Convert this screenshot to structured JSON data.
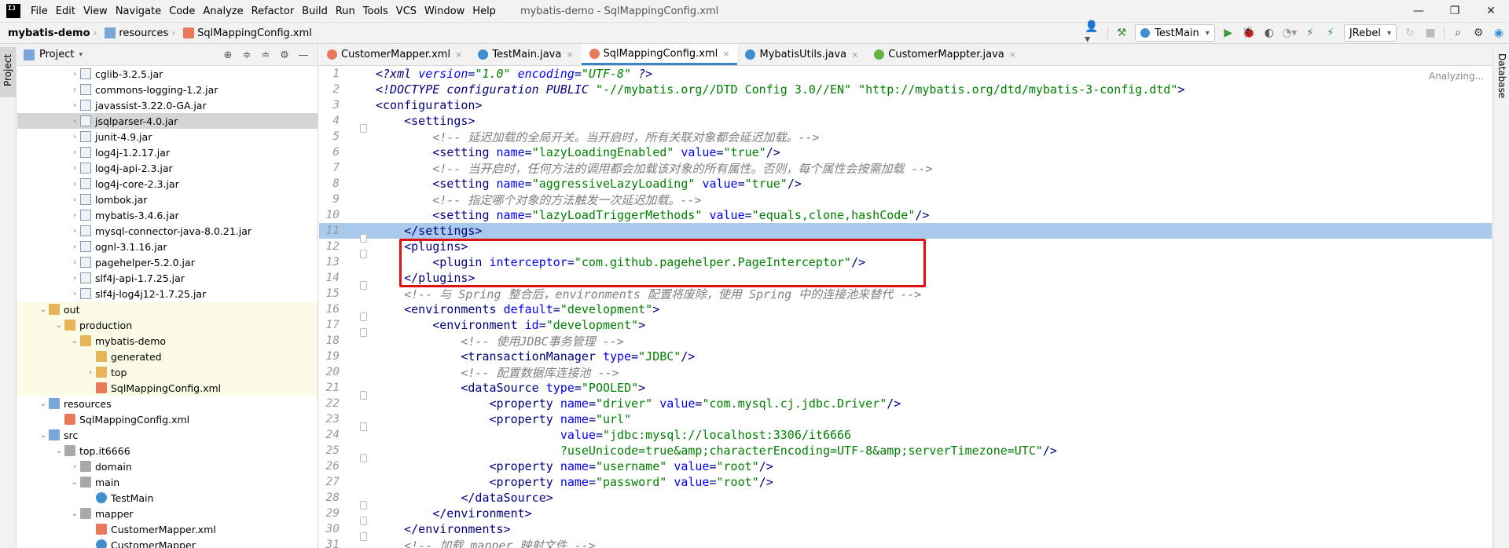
{
  "menubar": {
    "items": [
      "File",
      "Edit",
      "View",
      "Navigate",
      "Code",
      "Analyze",
      "Refactor",
      "Build",
      "Run",
      "Tools",
      "VCS",
      "Window",
      "Help"
    ],
    "window_title": "mybatis-demo - SqlMappingConfig.xml"
  },
  "navbar": {
    "breadcrumb": [
      "mybatis-demo",
      "resources",
      "SqlMappingConfig.xml"
    ],
    "run_config": "TestMain",
    "jrebel": "JRebel"
  },
  "left_stripe": {
    "project_label": "Project"
  },
  "right_stripe": {
    "database_label": "Database"
  },
  "project_panel": {
    "title": "Project",
    "tree": [
      {
        "label": "cglib-3.2.5.jar",
        "indent": 3,
        "arrow": "›",
        "icon": "jar",
        "selected": false,
        "excluded": false
      },
      {
        "label": "commons-logging-1.2.jar",
        "indent": 3,
        "arrow": "›",
        "icon": "jar",
        "selected": false,
        "excluded": false
      },
      {
        "label": "javassist-3.22.0-GA.jar",
        "indent": 3,
        "arrow": "›",
        "icon": "jar",
        "selected": false,
        "excluded": false
      },
      {
        "label": "jsqlparser-4.0.jar",
        "indent": 3,
        "arrow": "›",
        "icon": "jar",
        "selected": true,
        "excluded": false
      },
      {
        "label": "junit-4.9.jar",
        "indent": 3,
        "arrow": "›",
        "icon": "jar",
        "selected": false,
        "excluded": false
      },
      {
        "label": "log4j-1.2.17.jar",
        "indent": 3,
        "arrow": "›",
        "icon": "jar",
        "selected": false,
        "excluded": false
      },
      {
        "label": "log4j-api-2.3.jar",
        "indent": 3,
        "arrow": "›",
        "icon": "jar",
        "selected": false,
        "excluded": false
      },
      {
        "label": "log4j-core-2.3.jar",
        "indent": 3,
        "arrow": "›",
        "icon": "jar",
        "selected": false,
        "excluded": false
      },
      {
        "label": "lombok.jar",
        "indent": 3,
        "arrow": "›",
        "icon": "jar",
        "selected": false,
        "excluded": false
      },
      {
        "label": "mybatis-3.4.6.jar",
        "indent": 3,
        "arrow": "›",
        "icon": "jar",
        "selected": false,
        "excluded": false
      },
      {
        "label": "mysql-connector-java-8.0.21.jar",
        "indent": 3,
        "arrow": "›",
        "icon": "jar",
        "selected": false,
        "excluded": false
      },
      {
        "label": "ognl-3.1.16.jar",
        "indent": 3,
        "arrow": "›",
        "icon": "jar",
        "selected": false,
        "excluded": false
      },
      {
        "label": "pagehelper-5.2.0.jar",
        "indent": 3,
        "arrow": "›",
        "icon": "jar",
        "selected": false,
        "excluded": false
      },
      {
        "label": "slf4j-api-1.7.25.jar",
        "indent": 3,
        "arrow": "›",
        "icon": "jar",
        "selected": false,
        "excluded": false
      },
      {
        "label": "slf4j-log4j12-1.7.25.jar",
        "indent": 3,
        "arrow": "›",
        "icon": "jar",
        "selected": false,
        "excluded": false
      },
      {
        "label": "out",
        "indent": 1,
        "arrow": "⌄",
        "icon": "folder",
        "selected": false,
        "excluded": true
      },
      {
        "label": "production",
        "indent": 2,
        "arrow": "⌄",
        "icon": "folder",
        "selected": false,
        "excluded": true
      },
      {
        "label": "mybatis-demo",
        "indent": 3,
        "arrow": "⌄",
        "icon": "folder",
        "selected": false,
        "excluded": true
      },
      {
        "label": "generated",
        "indent": 4,
        "arrow": "",
        "icon": "folder",
        "selected": false,
        "excluded": true
      },
      {
        "label": "top",
        "indent": 4,
        "arrow": "›",
        "icon": "folder",
        "selected": false,
        "excluded": true
      },
      {
        "label": "SqlMappingConfig.xml",
        "indent": 4,
        "arrow": "",
        "icon": "xml",
        "selected": false,
        "excluded": true
      },
      {
        "label": "resources",
        "indent": 1,
        "arrow": "⌄",
        "icon": "folder-blue",
        "selected": false,
        "excluded": false
      },
      {
        "label": "SqlMappingConfig.xml",
        "indent": 2,
        "arrow": "",
        "icon": "xml",
        "selected": false,
        "excluded": false
      },
      {
        "label": "src",
        "indent": 1,
        "arrow": "⌄",
        "icon": "folder-blue",
        "selected": false,
        "excluded": false
      },
      {
        "label": "top.it6666",
        "indent": 2,
        "arrow": "⌄",
        "icon": "pkg",
        "selected": false,
        "excluded": false
      },
      {
        "label": "domain",
        "indent": 3,
        "arrow": "›",
        "icon": "pkg",
        "selected": false,
        "excluded": false
      },
      {
        "label": "main",
        "indent": 3,
        "arrow": "⌄",
        "icon": "pkg",
        "selected": false,
        "excluded": false
      },
      {
        "label": "TestMain",
        "indent": 4,
        "arrow": "",
        "icon": "class",
        "selected": false,
        "excluded": false
      },
      {
        "label": "mapper",
        "indent": 3,
        "arrow": "⌄",
        "icon": "pkg",
        "selected": false,
        "excluded": false
      },
      {
        "label": "CustomerMapper.xml",
        "indent": 4,
        "arrow": "",
        "icon": "xml",
        "selected": false,
        "excluded": false
      },
      {
        "label": "CustomerMapper",
        "indent": 4,
        "arrow": "",
        "icon": "class",
        "selected": false,
        "excluded": false
      }
    ]
  },
  "editor": {
    "tabs": [
      {
        "label": "CustomerMapper.xml",
        "icon_color": "#e8795a",
        "active": false
      },
      {
        "label": "TestMain.java",
        "icon_color": "#3e8ed0",
        "active": false
      },
      {
        "label": "SqlMappingConfig.xml",
        "icon_color": "#e8795a",
        "active": true
      },
      {
        "label": "MybatisUtils.java",
        "icon_color": "#3e8ed0",
        "active": false
      },
      {
        "label": "CustomerMappter.java",
        "icon_color": "#62b543",
        "active": false
      }
    ],
    "status": "Analyzing...",
    "current_line": 11,
    "lines": [
      {
        "n": "1",
        "fold": false,
        "seg": [
          [
            "pi",
            "<?xml "
          ],
          [
            "piattr",
            "version"
          ],
          [
            "pi",
            "="
          ],
          [
            "pival",
            "\"1.0\""
          ],
          [
            "pi",
            " "
          ],
          [
            "piattr",
            "encoding"
          ],
          [
            "pi",
            "="
          ],
          [
            "pival",
            "\"UTF-8\""
          ],
          [
            "pi",
            " ?>"
          ]
        ]
      },
      {
        "n": "2",
        "fold": false,
        "seg": [
          [
            "doctype",
            "<!DOCTYPE configuration PUBLIC "
          ],
          [
            "val",
            "\"-//mybatis.org//DTD Config 3.0//EN\""
          ],
          [
            "doctype",
            " "
          ],
          [
            "val",
            "\"http://mybatis.org/dtd/mybatis-3-config.dtd\""
          ],
          [
            "doctype",
            ">"
          ]
        ]
      },
      {
        "n": "3",
        "fold": false,
        "seg": [
          [
            "tag",
            "<configuration>"
          ]
        ]
      },
      {
        "n": "4",
        "fold": true,
        "seg": [
          [
            "text",
            "    "
          ],
          [
            "tag",
            "<settings>"
          ]
        ]
      },
      {
        "n": "5",
        "fold": false,
        "seg": [
          [
            "text",
            "        "
          ],
          [
            "com",
            "<!-- 延迟加载的全局开关。当开启时，所有关联对象都会延迟加载。-->"
          ]
        ]
      },
      {
        "n": "6",
        "fold": false,
        "seg": [
          [
            "text",
            "        "
          ],
          [
            "tag",
            "<setting "
          ],
          [
            "attr",
            "name"
          ],
          [
            "tag",
            "="
          ],
          [
            "val",
            "\"lazyLoadingEnabled\""
          ],
          [
            "tag",
            " "
          ],
          [
            "attr",
            "value"
          ],
          [
            "tag",
            "="
          ],
          [
            "val",
            "\"true\""
          ],
          [
            "tag",
            "/>"
          ]
        ]
      },
      {
        "n": "7",
        "fold": false,
        "seg": [
          [
            "text",
            "        "
          ],
          [
            "com",
            "<!-- 当开启时，任何方法的调用都会加载该对象的所有属性。否则，每个属性会按需加载 -->"
          ]
        ]
      },
      {
        "n": "8",
        "fold": false,
        "seg": [
          [
            "text",
            "        "
          ],
          [
            "tag",
            "<setting "
          ],
          [
            "attr",
            "name"
          ],
          [
            "tag",
            "="
          ],
          [
            "val",
            "\"aggressiveLazyLoading\""
          ],
          [
            "tag",
            " "
          ],
          [
            "attr",
            "value"
          ],
          [
            "tag",
            "="
          ],
          [
            "val",
            "\"true\""
          ],
          [
            "tag",
            "/>"
          ]
        ]
      },
      {
        "n": "9",
        "fold": false,
        "seg": [
          [
            "text",
            "        "
          ],
          [
            "com",
            "<!-- 指定哪个对象的方法触发一次延迟加载。-->"
          ]
        ]
      },
      {
        "n": "10",
        "fold": false,
        "seg": [
          [
            "text",
            "        "
          ],
          [
            "tag",
            "<setting "
          ],
          [
            "attr",
            "name"
          ],
          [
            "tag",
            "="
          ],
          [
            "val",
            "\"lazyLoadTriggerMethods\""
          ],
          [
            "tag",
            " "
          ],
          [
            "attr",
            "value"
          ],
          [
            "tag",
            "="
          ],
          [
            "val",
            "\"equals,clone,hashCode\""
          ],
          [
            "tag",
            "/>"
          ]
        ]
      },
      {
        "n": "11",
        "fold": true,
        "seg": [
          [
            "text",
            "    "
          ],
          [
            "tag",
            "</settings>"
          ]
        ]
      },
      {
        "n": "12",
        "fold": true,
        "seg": [
          [
            "text",
            "    "
          ],
          [
            "tag",
            "<plugins>"
          ]
        ]
      },
      {
        "n": "13",
        "fold": false,
        "seg": [
          [
            "text",
            "        "
          ],
          [
            "tag",
            "<plugin "
          ],
          [
            "attr",
            "interceptor"
          ],
          [
            "tag",
            "="
          ],
          [
            "val",
            "\"com.github.pagehelper.PageInterceptor\""
          ],
          [
            "tag",
            "/>"
          ]
        ]
      },
      {
        "n": "14",
        "fold": true,
        "seg": [
          [
            "text",
            "    "
          ],
          [
            "tag",
            "</plugins>"
          ]
        ]
      },
      {
        "n": "15",
        "fold": false,
        "seg": [
          [
            "text",
            "    "
          ],
          [
            "com",
            "<!-- 与 Spring 整合后，environments 配置将废除，使用 Spring 中的连接池来替代 -->"
          ]
        ]
      },
      {
        "n": "16",
        "fold": true,
        "seg": [
          [
            "text",
            "    "
          ],
          [
            "tag",
            "<environments "
          ],
          [
            "attr",
            "default"
          ],
          [
            "tag",
            "="
          ],
          [
            "val",
            "\"development\""
          ],
          [
            "tag",
            ">"
          ]
        ]
      },
      {
        "n": "17",
        "fold": true,
        "seg": [
          [
            "text",
            "        "
          ],
          [
            "tag",
            "<environment "
          ],
          [
            "attr",
            "id"
          ],
          [
            "tag",
            "="
          ],
          [
            "val",
            "\"development\""
          ],
          [
            "tag",
            ">"
          ]
        ]
      },
      {
        "n": "18",
        "fold": false,
        "seg": [
          [
            "text",
            "            "
          ],
          [
            "com",
            "<!-- 使用JDBC事务管理 -->"
          ]
        ]
      },
      {
        "n": "19",
        "fold": false,
        "seg": [
          [
            "text",
            "            "
          ],
          [
            "tag",
            "<transactionManager "
          ],
          [
            "attr",
            "type"
          ],
          [
            "tag",
            "="
          ],
          [
            "val",
            "\"JDBC\""
          ],
          [
            "tag",
            "/>"
          ]
        ]
      },
      {
        "n": "20",
        "fold": false,
        "seg": [
          [
            "text",
            "            "
          ],
          [
            "com",
            "<!-- 配置数据库连接池 -->"
          ]
        ]
      },
      {
        "n": "21",
        "fold": true,
        "seg": [
          [
            "text",
            "            "
          ],
          [
            "tag",
            "<dataSource "
          ],
          [
            "attr",
            "type"
          ],
          [
            "tag",
            "="
          ],
          [
            "val",
            "\"POOLED\""
          ],
          [
            "tag",
            ">"
          ]
        ]
      },
      {
        "n": "22",
        "fold": false,
        "seg": [
          [
            "text",
            "                "
          ],
          [
            "tag",
            "<property "
          ],
          [
            "attr",
            "name"
          ],
          [
            "tag",
            "="
          ],
          [
            "val",
            "\"driver\""
          ],
          [
            "tag",
            " "
          ],
          [
            "attr",
            "value"
          ],
          [
            "tag",
            "="
          ],
          [
            "val",
            "\"com.mysql.cj.jdbc.Driver\""
          ],
          [
            "tag",
            "/>"
          ]
        ]
      },
      {
        "n": "23",
        "fold": true,
        "seg": [
          [
            "text",
            "                "
          ],
          [
            "tag",
            "<property "
          ],
          [
            "attr",
            "name"
          ],
          [
            "tag",
            "="
          ],
          [
            "val",
            "\"url\""
          ]
        ]
      },
      {
        "n": "24",
        "fold": false,
        "seg": [
          [
            "text",
            "                          "
          ],
          [
            "attr",
            "value"
          ],
          [
            "tag",
            "="
          ],
          [
            "val",
            "\"jdbc:mysql://localhost:3306/it6666"
          ]
        ]
      },
      {
        "n": "25",
        "fold": true,
        "seg": [
          [
            "text",
            "                          "
          ],
          [
            "val",
            "?useUnicode=true&amp;characterEncoding=UTF-8&amp;serverTimezone=UTC\""
          ],
          [
            "tag",
            "/>"
          ]
        ]
      },
      {
        "n": "26",
        "fold": false,
        "seg": [
          [
            "text",
            "                "
          ],
          [
            "tag",
            "<property "
          ],
          [
            "attr",
            "name"
          ],
          [
            "tag",
            "="
          ],
          [
            "val",
            "\"username\""
          ],
          [
            "tag",
            " "
          ],
          [
            "attr",
            "value"
          ],
          [
            "tag",
            "="
          ],
          [
            "val",
            "\"root\""
          ],
          [
            "tag",
            "/>"
          ]
        ]
      },
      {
        "n": "27",
        "fold": false,
        "seg": [
          [
            "text",
            "                "
          ],
          [
            "tag",
            "<property "
          ],
          [
            "attr",
            "name"
          ],
          [
            "tag",
            "="
          ],
          [
            "val",
            "\"password\""
          ],
          [
            "tag",
            " "
          ],
          [
            "attr",
            "value"
          ],
          [
            "tag",
            "="
          ],
          [
            "val",
            "\"root\""
          ],
          [
            "tag",
            "/>"
          ]
        ]
      },
      {
        "n": "28",
        "fold": true,
        "seg": [
          [
            "text",
            "            "
          ],
          [
            "tag",
            "</dataSource>"
          ]
        ]
      },
      {
        "n": "29",
        "fold": true,
        "seg": [
          [
            "text",
            "        "
          ],
          [
            "tag",
            "</environment>"
          ]
        ]
      },
      {
        "n": "30",
        "fold": true,
        "seg": [
          [
            "text",
            "    "
          ],
          [
            "tag",
            "</environments>"
          ]
        ]
      },
      {
        "n": "31",
        "fold": false,
        "seg": [
          [
            "text",
            "    "
          ],
          [
            "com",
            "<!-- 加载 mapper 映射文件 -->"
          ]
        ]
      }
    ]
  },
  "colors": {
    "accent": "#4083c9",
    "current_line": "#a9c9ed",
    "highlight_box": "#e01010"
  }
}
